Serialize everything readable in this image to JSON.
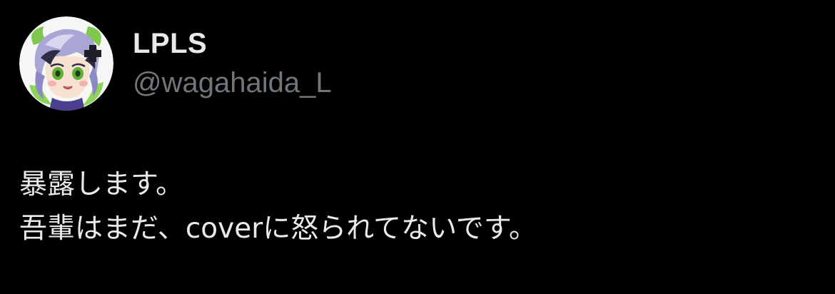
{
  "author": {
    "display_name": "LPLS",
    "username": "@wagahaida_L",
    "avatar_icon": "avatar-icon"
  },
  "tweet": {
    "lines": [
      "暴露します。",
      "吾輩はまだ、coverに怒られてないです。"
    ]
  },
  "colors": {
    "background": "#000000",
    "text_primary": "#e7e9ea",
    "text_secondary": "#71767b"
  }
}
